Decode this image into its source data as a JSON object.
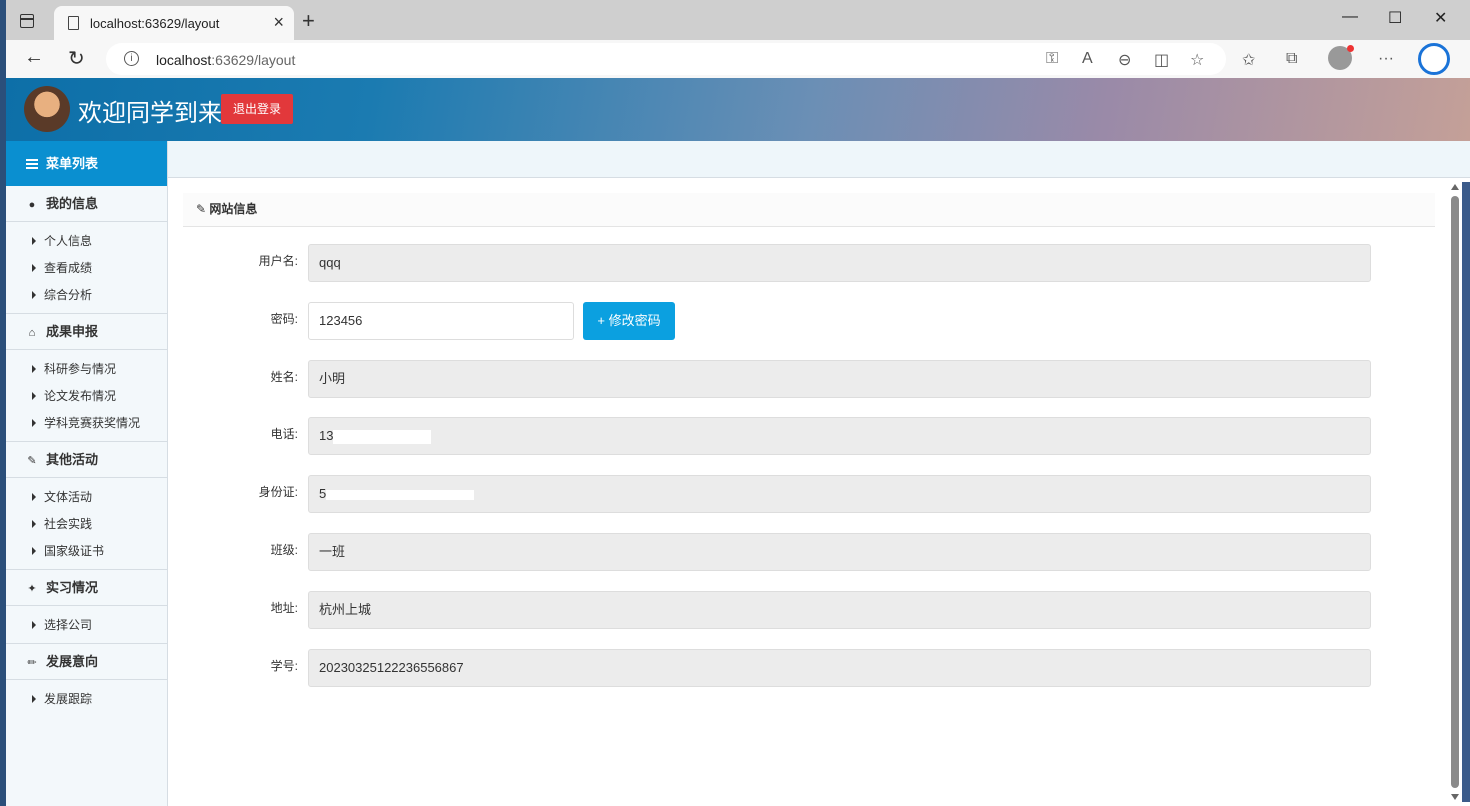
{
  "browser": {
    "tab_title": "localhost:63629/layout",
    "url_host": "localhost",
    "url_rest": ":63629/layout"
  },
  "header": {
    "welcome": "欢迎同学到来",
    "logout": "退出登录"
  },
  "sidebar": {
    "title": "菜单列表",
    "groups": [
      {
        "label": "我的信息",
        "icon": "user-icon",
        "items": [
          "个人信息",
          "查看成绩",
          "综合分析"
        ]
      },
      {
        "label": "成果申报",
        "icon": "home-icon",
        "items": [
          "科研参与情况",
          "论文发布情况",
          "学科竞赛获奖情况"
        ]
      },
      {
        "label": "其他活动",
        "icon": "edit-icon",
        "items": [
          "文体活动",
          "社会实践",
          "国家级证书"
        ]
      },
      {
        "label": "实习情况",
        "icon": "wrench-icon",
        "items": [
          "选择公司"
        ]
      },
      {
        "label": "发展意向",
        "icon": "pencil-icon",
        "items": [
          "发展跟踪"
        ]
      }
    ]
  },
  "panel": {
    "title": "网站信息",
    "fields": [
      {
        "label": "用户名:",
        "value": "qqq"
      },
      {
        "label": "密码:",
        "value": "123456"
      },
      {
        "label": "姓名:",
        "value": "小明"
      },
      {
        "label": "电话:",
        "value": "13"
      },
      {
        "label": "身份证:",
        "value": "5"
      },
      {
        "label": "班级:",
        "value": "一班"
      },
      {
        "label": "地址:",
        "value": "杭州上城"
      },
      {
        "label": "学号:",
        "value": "20230325122236556867"
      }
    ],
    "change_password": "+ 修改密码"
  }
}
